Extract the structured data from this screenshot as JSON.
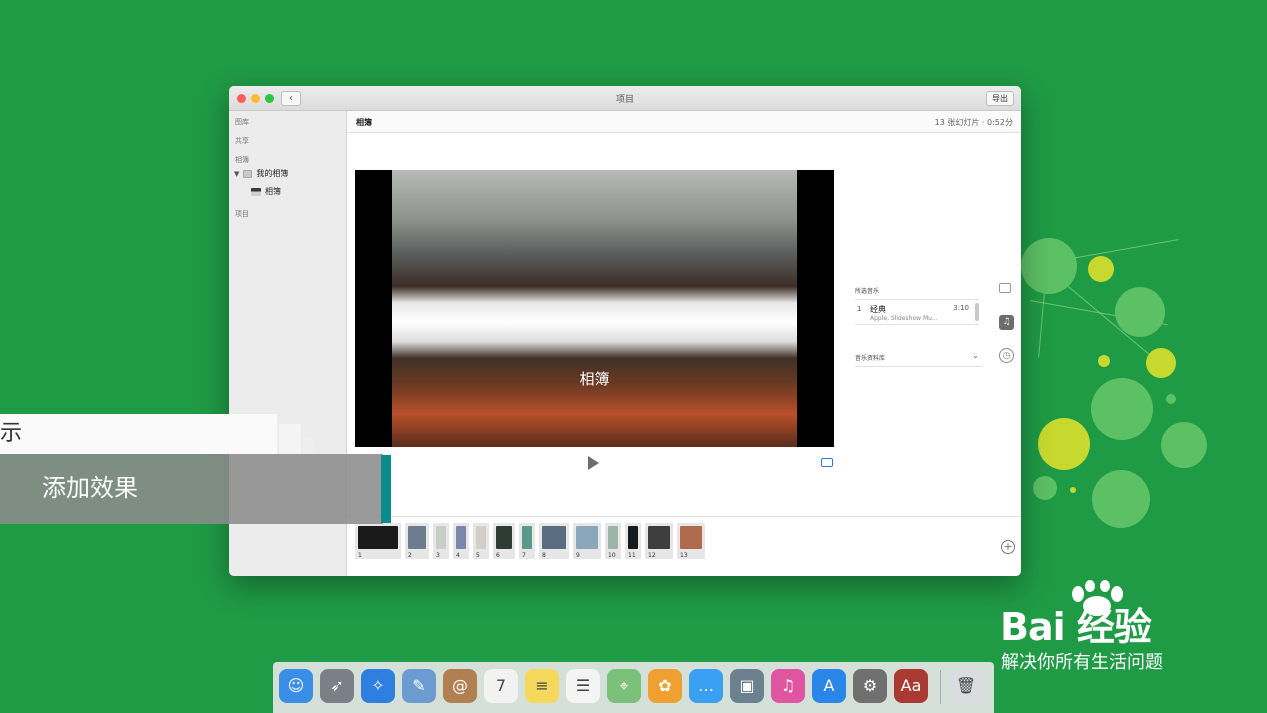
{
  "window": {
    "title": "项目",
    "back_glyph": "‹",
    "export_label": "导出"
  },
  "sidebar": {
    "sections": [
      "图库",
      "共享",
      "相簿",
      "项目"
    ],
    "my_albums": "我的相簿",
    "album": "相簿"
  },
  "project": {
    "name": "相簿",
    "info": "13 张幻灯片 · 0:52分"
  },
  "preview": {
    "caption": "相簿"
  },
  "music_panel": {
    "selected_label": "所选音乐",
    "track_index": "1",
    "track_title": "经典",
    "track_artist": "Apple, Slideshow Mu...",
    "track_duration": "3:10",
    "library_label": "音乐资料库",
    "chevron": "⌄"
  },
  "side_icons": {
    "music_glyph": "♫",
    "timer_glyph": "◷"
  },
  "timeline": {
    "slides": [
      {
        "num": "1",
        "color": "#1a1a1a"
      },
      {
        "num": "2",
        "color": "#6d7c8e"
      },
      {
        "num": "3",
        "color": "#c8cfc7"
      },
      {
        "num": "4",
        "color": "#7b86a8"
      },
      {
        "num": "5",
        "color": "#d0d0c8"
      },
      {
        "num": "6",
        "color": "#2f3b35"
      },
      {
        "num": "7",
        "color": "#5b9a8a"
      },
      {
        "num": "8",
        "color": "#5a6c80"
      },
      {
        "num": "9",
        "color": "#8aa7bc"
      },
      {
        "num": "10",
        "color": "#9fb4a8"
      },
      {
        "num": "11",
        "color": "#161a1e"
      },
      {
        "num": "12",
        "color": "#3e3e3e"
      },
      {
        "num": "13",
        "color": "#b06a4c"
      }
    ],
    "add_glyph": "+"
  },
  "overlay": {
    "top_text": "示",
    "bottom_text": "添加效果"
  },
  "watermark": {
    "brand": "Bai  经验",
    "slogan": "解决你所有生活问题"
  },
  "dock": {
    "apps": [
      {
        "name": "finder-icon",
        "color": "#3b8ee6",
        "glyph": "☺"
      },
      {
        "name": "launchpad-icon",
        "color": "#7a7f88",
        "glyph": "➶"
      },
      {
        "name": "safari-icon",
        "color": "#2f7fe0",
        "glyph": "✧"
      },
      {
        "name": "preview-icon",
        "color": "#6b9bd1",
        "glyph": "✎"
      },
      {
        "name": "contacts-icon",
        "color": "#b08050",
        "glyph": "@"
      },
      {
        "name": "calendar-icon",
        "color": "#f2f2f2",
        "glyph": "7"
      },
      {
        "name": "notes-icon",
        "color": "#f5d85c",
        "glyph": "≡"
      },
      {
        "name": "reminders-icon",
        "color": "#f4f4f4",
        "glyph": "☰"
      },
      {
        "name": "maps-icon",
        "color": "#7cc07a",
        "glyph": "⌖"
      },
      {
        "name": "photos-icon",
        "color": "#f0a030",
        "glyph": "✿"
      },
      {
        "name": "messages-icon",
        "color": "#3aa0f2",
        "glyph": "…"
      },
      {
        "name": "image-capture-icon",
        "color": "#6c8090",
        "glyph": "▣"
      },
      {
        "name": "itunes-icon",
        "color": "#e055a0",
        "glyph": "♫"
      },
      {
        "name": "app-store-icon",
        "color": "#2a86e8",
        "glyph": "A"
      },
      {
        "name": "system-preferences-icon",
        "color": "#707070",
        "glyph": "⚙"
      },
      {
        "name": "dictionary-icon",
        "color": "#a83a33",
        "glyph": "Aa"
      },
      {
        "name": "trash-icon",
        "color": "#d9dde0",
        "glyph": "🗑"
      }
    ]
  }
}
